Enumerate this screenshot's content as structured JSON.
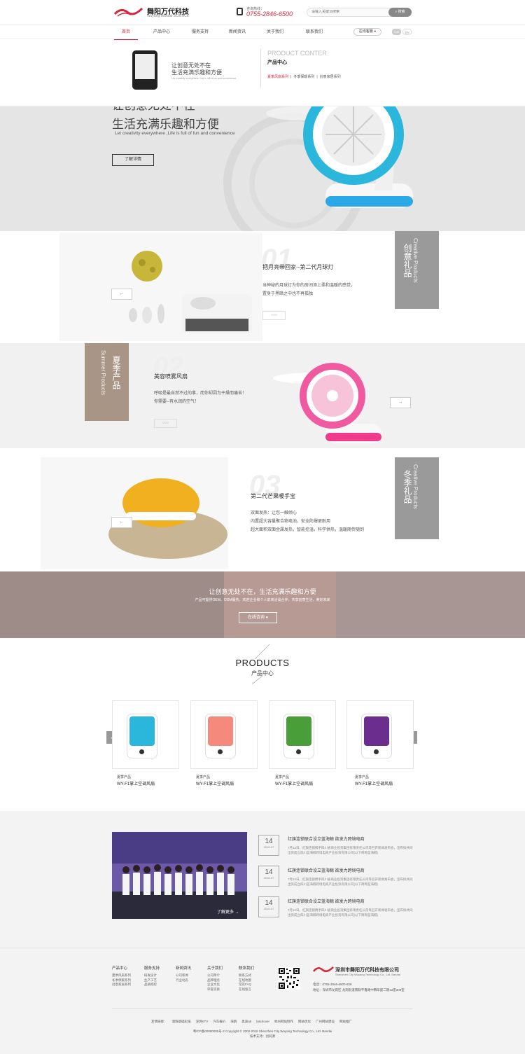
{
  "header": {
    "logo_cn": "舞阳万代科技",
    "logo_en": "Wuyang Wandai SCIENCE",
    "phone_label": "咨询热线：",
    "phone": "0755-2846-6500",
    "search_placeholder": "请输入关键词搜索",
    "search_button": "搜索"
  },
  "nav": {
    "items": [
      "首页",
      "产品中心",
      "服务支持",
      "新闻资讯",
      "关于我们",
      "联系我们"
    ],
    "online": "在线客服",
    "lang_cn": "CN",
    "lang_en": "EN"
  },
  "dropdown": {
    "slogan1": "让创意无处不在",
    "slogan2": "生活充满乐趣和方便",
    "slogan_en": "Let creativity everywhere ,Life is full of fun and convenience",
    "title_en": "PRODUCT CONTER",
    "title_cn": "产品中心",
    "links": [
      "夏季风扇系列",
      "|",
      "冬季保暖系列",
      "|",
      "创意家居系列"
    ]
  },
  "banner": {
    "line1": "让创意无处不在",
    "line2": "生活充满乐趣和方便",
    "line_en": "Let creativity everywhere ,Life is full of fun and convenience",
    "button": "了解详情"
  },
  "rows": [
    {
      "num": "01",
      "title": "把月亮带回家--第二代月球灯",
      "desc1": "当神秘的月球灯为你的房间添上柔和温暖的感觉，",
      "desc2": "置身于黑暗之中也不再孤独",
      "desc3": "",
      "desc4": "",
      "more": "○○○",
      "tag_cn": "创意礼品",
      "tag_en": "Creative Products"
    },
    {
      "num": "02",
      "title": "美容喷雾风扇",
      "desc1": "呼吸是最自然不过的事，而你却因为干燥而痛苦！",
      "desc2": "你需要--有水润的空气！",
      "desc3": "",
      "desc4": "",
      "more": "○○○",
      "tag_cn": "夏季产品",
      "tag_en": "Summer Products"
    },
    {
      "num": "03",
      "title": "第二代芒果暖手宝",
      "desc1": "双面发热：让您一触倾心",
      "desc2": "内置超大容量聚合物电池，安全防爆更耐用",
      "desc3": "超大面积双面金属发热，智能控温，科学供热，温暖随传随到",
      "desc4": "",
      "more": "",
      "tag_cn": "冬季礼品",
      "tag_en": "Creative Products"
    }
  ],
  "cta": {
    "title": "让创意无处不在，生活充满乐趣和方便",
    "subtitle": "产品可提供OEM、ODM服务，欢迎企业和个人前来洽谈合作，共享创意生活，美好未来",
    "button": "在线咨询"
  },
  "products": {
    "title_en": "PRODUCTS",
    "title_cn": "产品中心",
    "items": [
      {
        "category": "夏季产品",
        "name": "WY-F1掌上空调风扇",
        "color": "#2bb6dc"
      },
      {
        "category": "夏季产品",
        "name": "WY-F1掌上空调风扇",
        "color": "#f58a7c"
      },
      {
        "category": "夏季产品",
        "name": "WY-F1掌上空调风扇",
        "color": "#4a9e3a"
      },
      {
        "category": "夏季产品",
        "name": "WY-F1掌上空调风扇",
        "color": "#6b2d8e"
      }
    ]
  },
  "news": {
    "more": "了解更多 →",
    "items": [
      {
        "day": "14",
        "ym": "2016-07",
        "title": "红旗连锁联合设立蓝海鲸 欲发力跨境电商",
        "desc": "7月12日，红旗连锁携手四川省商业投资集团有限责任公司等召开新闻发布会，宣布拟共同出资成立四川蓝海鲸跨境电商产业投资有限公司(以下简称蓝海鲸)"
      },
      {
        "day": "14",
        "ym": "2016-07",
        "title": "红旗连锁联合设立蓝海鲸 欲发力跨境电商",
        "desc": "7月12日，红旗连锁携手四川省商业投资集团有限责任公司等召开新闻发布会，宣布拟共同出资成立四川蓝海鲸跨境电商产业投资有限公司(以下简称蓝海鲸)"
      },
      {
        "day": "14",
        "ym": "2016-07",
        "title": "红旗连锁联合设立蓝海鲸 欲发力跨境电商",
        "desc": "7月12日，红旗连锁携手四川省商业投资集团有限责任公司等召开新闻发布会，宣布拟共同出资成立四川蓝海鲸跨境电商产业投资有限公司(以下简称蓝海鲸)"
      }
    ]
  },
  "footer": {
    "cols": [
      {
        "head": "产品中心",
        "links": [
          "夏季风扇系列",
          "冬季保暖系列",
          "创意家居系列"
        ]
      },
      {
        "head": "服务支持",
        "links": [
          "研发设计",
          "生产工艺",
          "品质把控"
        ]
      },
      {
        "head": "新闻资讯",
        "links": [
          "公司新闻",
          "行业动态"
        ]
      },
      {
        "head": "关于我们",
        "links": [
          "公司简介",
          "品牌理念",
          "企业文化",
          "荣誉资质"
        ]
      },
      {
        "head": "联系我们",
        "links": [
          "联系方式",
          "在线地图",
          "常见FAQ",
          "在线留言"
        ]
      }
    ],
    "company_cn": "深圳市舞阳万代科技有限公司",
    "company_en": "Shenzhen City Wuyang Technology Co., Ltd. Bandai",
    "tel": "电话：0755-2846-6500-828",
    "addr": "地址：深圳市龙岗区 龙岗街道南联平鲁路中腾华庭二期12座309室",
    "friend_links": [
      "友情链接：",
      "泪珠基础彩纸",
      "深圳KTV",
      "汽车报价",
      "海鸥",
      "奥迪a5",
      "landrover",
      "杭州网站制作",
      "网站优化",
      "广州网站建设",
      "网站推广"
    ],
    "copyright": "粤ICP备00000000号-2 Copyright © 2002-2016 Shenzhen City Wuyang Technology Co., Ltd. Bandai",
    "tech": "技术支持：创同源"
  }
}
